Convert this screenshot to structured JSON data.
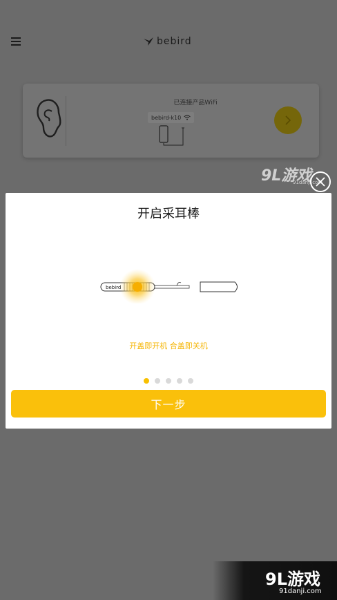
{
  "header": {
    "brand": "bebird",
    "menu_icon": "hamburger-menu-icon",
    "logo_icon": "bird-logo-icon"
  },
  "device_card": {
    "status_text": "已连接产品WiFi",
    "wifi_name": "bebird-k10",
    "icons": [
      "ear-icon",
      "wifi-icon",
      "phone-icon",
      "chevron-right-icon"
    ]
  },
  "modal": {
    "title": "开启采耳棒",
    "device_label": "bebird",
    "caption": "开盖即开机 合盖即关机",
    "pager": {
      "total": 5,
      "active_index": 0
    },
    "next_label": "下一步",
    "close_icon": "close-icon"
  },
  "watermarks": {
    "top_big": "9L游戏",
    "top_small": "91danji.com",
    "bottom_big": "9L游戏",
    "bottom_small": "91danji.com"
  },
  "colors": {
    "accent": "#fac00b",
    "caption": "#f5b400",
    "overlay": "#6b6b6b"
  }
}
